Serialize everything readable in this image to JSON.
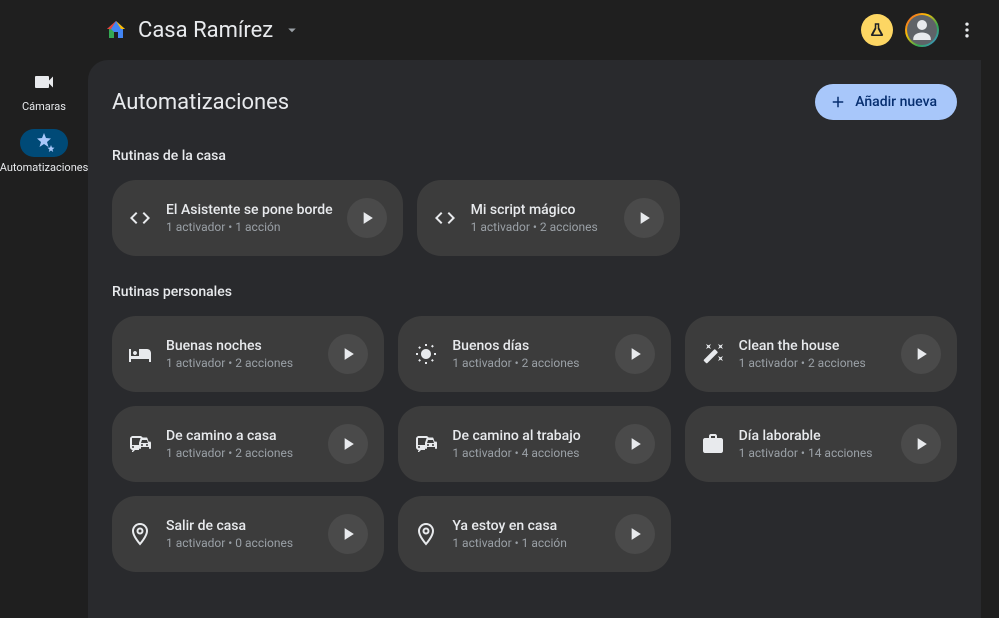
{
  "header": {
    "house_name": "Casa Ramírez"
  },
  "sidebar": {
    "items": [
      {
        "label": "Cámaras",
        "icon": "camera"
      },
      {
        "label": "Automatizaciones",
        "icon": "automation"
      }
    ]
  },
  "page": {
    "title": "Automatizaciones",
    "add_button": "Añadir nueva"
  },
  "sections": {
    "house": {
      "title": "Rutinas de la casa",
      "cards": [
        {
          "title": "El Asistente se pone borde",
          "subtitle": "1 activador • 1 acción",
          "icon": "code"
        },
        {
          "title": "Mi script mágico",
          "subtitle": "1 activador • 2 acciones",
          "icon": "code"
        }
      ]
    },
    "personal": {
      "title": "Rutinas personales",
      "cards": [
        {
          "title": "Buenas noches",
          "subtitle": "1 activador • 2 acciones",
          "icon": "bed"
        },
        {
          "title": "Buenos días",
          "subtitle": "1 activador • 2 acciones",
          "icon": "sun"
        },
        {
          "title": "Clean the house",
          "subtitle": "1 activador • 2 acciones",
          "icon": "wand"
        },
        {
          "title": "De camino a casa",
          "subtitle": "1 activador • 2 acciones",
          "icon": "commute"
        },
        {
          "title": "De camino al trabajo",
          "subtitle": "1 activador • 4 acciones",
          "icon": "commute"
        },
        {
          "title": "Día laborable",
          "subtitle": "1 activador • 14 acciones",
          "icon": "business"
        },
        {
          "title": "Salir de casa",
          "subtitle": "1 activador • 0 acciones",
          "icon": "location"
        },
        {
          "title": "Ya estoy en casa",
          "subtitle": "1 activador • 1 acción",
          "icon": "location"
        }
      ]
    }
  }
}
